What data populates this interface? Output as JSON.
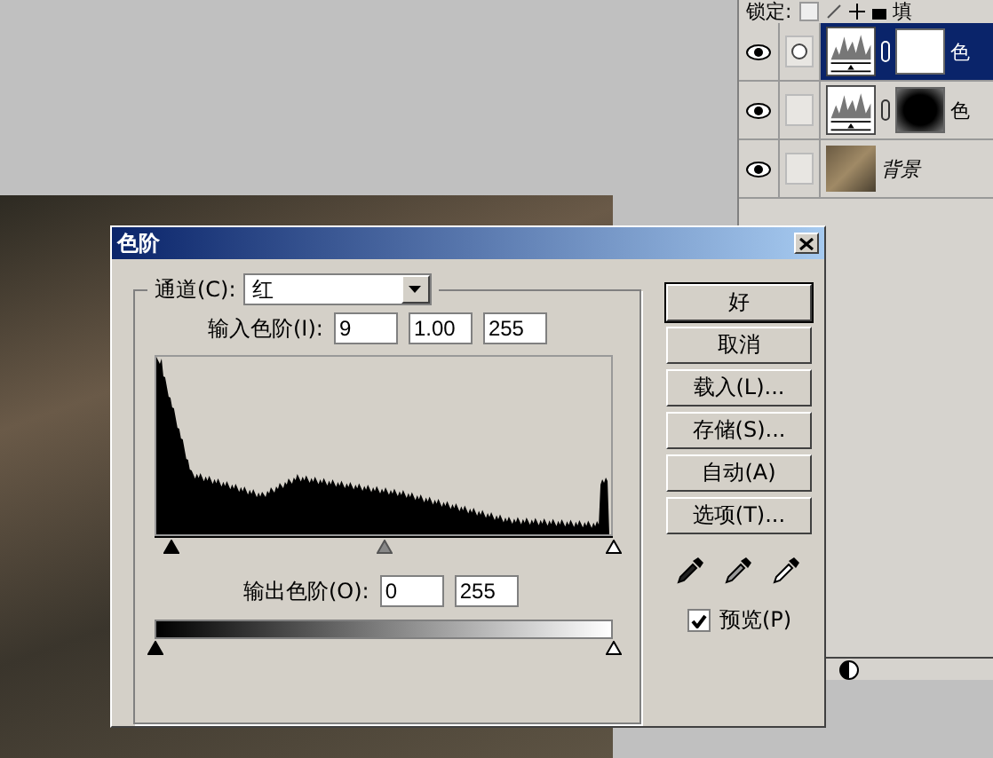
{
  "layers_panel": {
    "lock_label": "锁定:",
    "fill_label": "填",
    "layers": [
      {
        "name": "色",
        "kind": "adjustment",
        "selected": true,
        "visible": true,
        "mask_dark": false
      },
      {
        "name": "色",
        "kind": "adjustment",
        "selected": false,
        "visible": true,
        "mask_dark": true
      },
      {
        "name": "背景",
        "kind": "background",
        "selected": false,
        "visible": true
      }
    ]
  },
  "dialog": {
    "title": "色阶",
    "channel": {
      "label": "通道(C):",
      "value": "红"
    },
    "input_levels": {
      "label": "输入色阶(I):",
      "values": [
        "9",
        "1.00",
        "255"
      ]
    },
    "input_sliders": [
      {
        "level": 0.035
      },
      {
        "level": 0.5
      },
      {
        "level": 1
      }
    ],
    "output_levels": {
      "label": "输出色阶(O):",
      "values": [
        "0",
        "255"
      ]
    },
    "output_sliders": [
      {
        "level": 0
      },
      {
        "level": 1
      }
    ],
    "buttons": [
      {
        "label": "好",
        "default": true
      },
      {
        "label": "取消",
        "default": false
      },
      {
        "label": "载入(L)...",
        "default": false
      },
      {
        "label": "存储(S)...",
        "default": false
      },
      {
        "label": "自动(A)",
        "default": false
      },
      {
        "label": "选项(T)...",
        "default": false
      }
    ],
    "preview": {
      "label": "预览(P)",
      "checked": true
    }
  }
}
